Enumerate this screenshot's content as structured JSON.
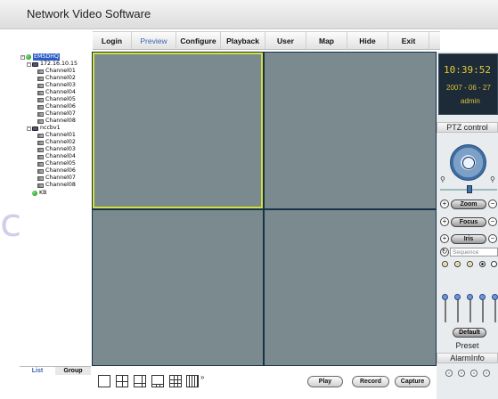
{
  "app": {
    "title": "Network Video Software"
  },
  "menu": {
    "items": [
      "Login",
      "Preview",
      "Configure",
      "Playback",
      "User",
      "Map",
      "Hide",
      "Exit"
    ],
    "active": "Preview"
  },
  "tree": {
    "root": "EMSDHQ",
    "nodes": [
      {
        "name": "172.16.10.15",
        "channels": [
          "Channel01",
          "Channel02",
          "Channel03",
          "Channel04",
          "Channel05",
          "Channel06",
          "Channel07",
          "Channel08"
        ]
      },
      {
        "name": "nccbv1",
        "channels": [
          "Channel01",
          "Channel02",
          "Channel03",
          "Channel04",
          "Channel05",
          "Channel06",
          "Channel07",
          "Channel08"
        ]
      }
    ],
    "extra": "KB"
  },
  "tabs": [
    "List",
    "Group"
  ],
  "bottom": {
    "buttons": [
      "Play",
      "Record",
      "Capture"
    ],
    "more": "»"
  },
  "status": {
    "time": "10:39:52",
    "date": "2007 - 06 - 27",
    "user": "admin"
  },
  "ptz": {
    "title": "PTZ control",
    "zoom": "Zoom",
    "focus": "Focus",
    "iris": "Iris",
    "sequence_placeholder": "Sequence",
    "default": "Default",
    "preset": "Preset",
    "alarm": "AlarmInfo"
  },
  "colors": {
    "accent": "#3a63b4",
    "selected_border": "#d3e03a",
    "video_bg": "#7b8a8f",
    "grid_border": "#17324a",
    "clock_text": "#e3cc3a"
  }
}
